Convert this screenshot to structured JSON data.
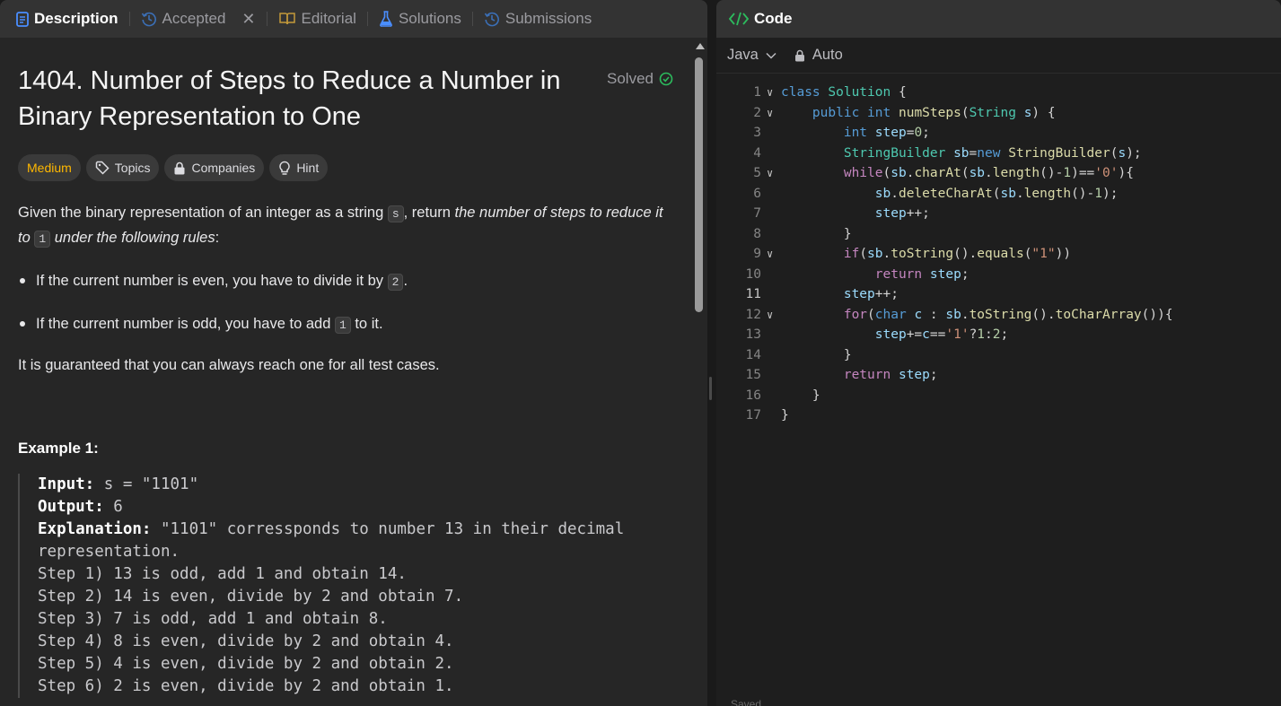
{
  "left": {
    "tabs": [
      {
        "label": "Description",
        "icon": "description-doc-icon",
        "active": true
      },
      {
        "label": "Accepted",
        "icon": "history-icon",
        "active": false
      },
      {
        "label": "Editorial",
        "icon": "book-icon",
        "active": false
      },
      {
        "label": "Solutions",
        "icon": "flask-icon",
        "active": false
      },
      {
        "label": "Submissions",
        "icon": "history-icon",
        "active": false
      }
    ],
    "close_glyph": "✕",
    "title": "1404. Number of Steps to Reduce a Number in Binary Representation to One",
    "solved_label": "Solved",
    "tags": {
      "difficulty": "Medium",
      "topics": "Topics",
      "companies": "Companies",
      "hint": "Hint"
    },
    "intro": {
      "part1": "Given the binary representation of an integer as a string ",
      "code_s": "s",
      "part2": ", return ",
      "em1": "the number of steps to reduce it to ",
      "code_1": "1",
      "em2": " under the following rules",
      "part3": ":"
    },
    "rules": [
      {
        "before": "If the current number is even, you have to divide it by ",
        "code": "2",
        "after": "."
      },
      {
        "before": "If the current number is odd, you have to add ",
        "code": "1",
        "after": " to it."
      }
    ],
    "guarantee": "It is guaranteed that you can always reach one for all test cases.",
    "example1": {
      "title": "Example 1:",
      "input_label": "Input:",
      "input_value": " s = \"1101\"",
      "output_label": "Output:",
      "output_value": " 6",
      "explanation_label": "Explanation:",
      "explanation_value": " \"1101\" corressponds to number 13 in their decimal",
      "explanation_cont": "representation.",
      "steps": [
        "Step 1) 13 is odd, add 1 and obtain 14. ",
        "Step 2) 14 is even, divide by 2 and obtain 7.",
        "Step 3) 7 is odd, add 1 and obtain 8.",
        "Step 4) 8 is even, divide by 2 and obtain 4.  ",
        "Step 5) 4 is even, divide by 2 and obtain 2. ",
        "Step 6) 2 is even, divide by 2 and obtain 1.  "
      ]
    }
  },
  "right": {
    "header": "Code",
    "language": "Java",
    "mode": "Auto",
    "saved": "Saved",
    "code_lines": [
      "class Solution {",
      "    public int numSteps(String s) {",
      "        int step=0;",
      "        StringBuilder sb=new StringBuilder(s);",
      "        while(sb.charAt(sb.length()-1)=='0'){",
      "            sb.deleteCharAt(sb.length()-1);",
      "            step++;",
      "        }",
      "        if(sb.toString().equals(\"1\"))",
      "            return step;",
      "        step++;",
      "        for(char c : sb.toString().toCharArray()){",
      "            step+=c=='1'?1:2;",
      "        }",
      "        return step;",
      "    }",
      "}"
    ],
    "line_numbers": [
      "1",
      "2",
      "3",
      "4",
      "5",
      "6",
      "7",
      "8",
      "9",
      "10",
      "11",
      "12",
      "13",
      "14",
      "15",
      "16",
      "17"
    ]
  },
  "colors": {
    "accent_blue": "#4a8eff",
    "medium": "#ffb800",
    "solved_green": "#2cbb5d",
    "code_icon_green": "#2cbb5d"
  }
}
